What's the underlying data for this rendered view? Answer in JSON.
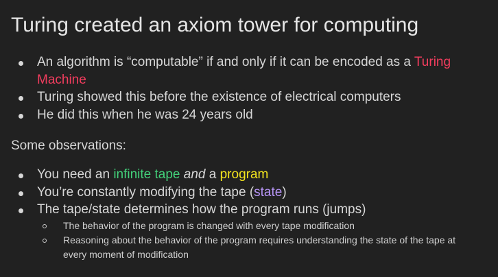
{
  "slide": {
    "title": "Turing created an axiom tower for computing",
    "bullets_primary": [
      {
        "parts": [
          {
            "text": "An algorithm is “computable” if and only if it can be encoded as a "
          },
          {
            "text": "Turing Machine",
            "color": "#f23d5e"
          }
        ]
      },
      {
        "parts": [
          {
            "text": "Turing showed this before the existence of electrical computers"
          }
        ]
      },
      {
        "parts": [
          {
            "text": "He did this when he was 24 years old"
          }
        ]
      }
    ],
    "observations_heading": "Some observations:",
    "bullets_secondary": [
      {
        "parts": [
          {
            "text": "You need an "
          },
          {
            "text": "infinite tape",
            "color": "#43d17a"
          },
          {
            "text": " "
          },
          {
            "text": "and",
            "style": "italic"
          },
          {
            "text": " a "
          },
          {
            "text": "program",
            "color": "#f3e41e"
          }
        ]
      },
      {
        "parts": [
          {
            "text": "You’re constantly modifying the tape ("
          },
          {
            "text": "state",
            "color": "#b694f5"
          },
          {
            "text": ")"
          }
        ]
      },
      {
        "parts": [
          {
            "text": "The tape/state determines how the program runs (jumps)"
          }
        ],
        "sub": [
          "The behavior of the program is changed with every tape modification",
          "Reasoning about the behavior of the program requires understanding the state of the tape at every moment of modification"
        ]
      }
    ]
  },
  "colors": {
    "background": "#212121",
    "text": "#d7d7d7",
    "turing_machine": "#f23d5e",
    "infinite_tape": "#43d17a",
    "program": "#f3e41e",
    "state": "#b694f5"
  }
}
